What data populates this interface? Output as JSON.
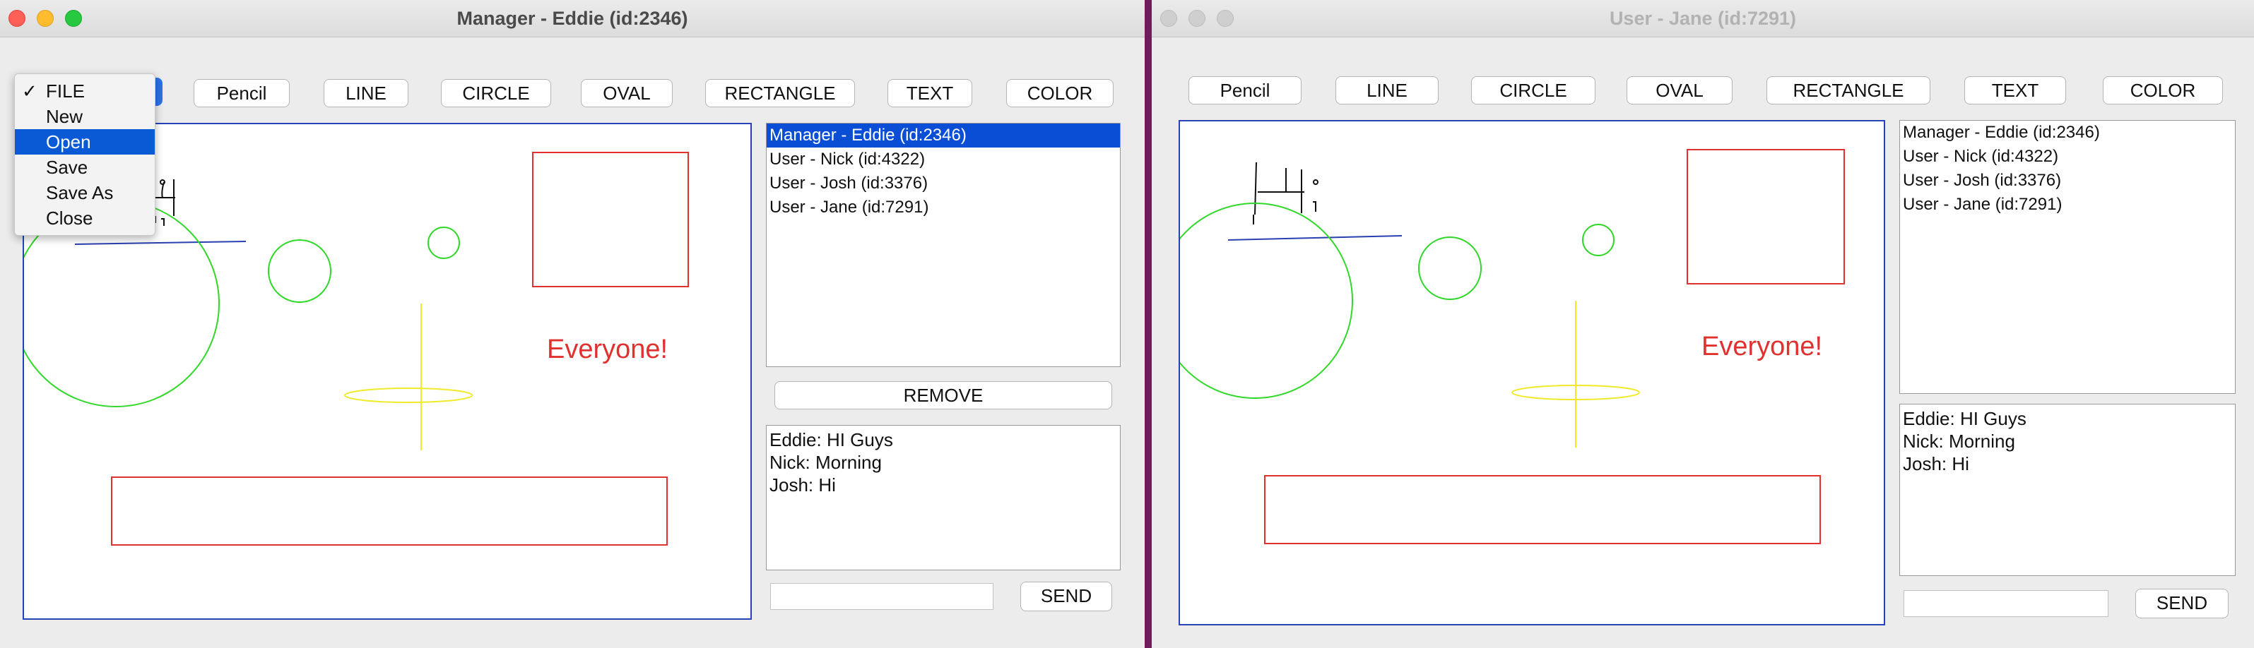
{
  "colors": {
    "canvas_border": "#2544b8",
    "red_shape": "#e0312f",
    "green_shape": "#31d82a",
    "yellow_shape": "#f0ea2a",
    "blue_line": "#2a3fb0",
    "selection": "#0a4ed6"
  },
  "manager_window": {
    "title": "Manager - Eddie (id:2346)",
    "file_menu": {
      "items": [
        {
          "label": "FILE",
          "checked": true
        },
        {
          "label": "New"
        },
        {
          "label": "Open",
          "highlighted": true
        },
        {
          "label": "Save"
        },
        {
          "label": "Save As"
        },
        {
          "label": "Close"
        }
      ]
    },
    "toolbar": [
      "Pencil",
      "LINE",
      "CIRCLE",
      "OVAL",
      "RECTANGLE",
      "TEXT",
      "COLOR"
    ],
    "canvas_text": "Everyone!",
    "users": [
      "Manager - Eddie (id:2346)",
      "User - Nick (id:4322)",
      "User - Josh (id:3376)",
      "User - Jane (id:7291)"
    ],
    "selected_user_index": 0,
    "remove_label": "REMOVE",
    "chat": [
      "Eddie: HI Guys",
      "Nick: Morning",
      "Josh: Hi"
    ],
    "message_input": "",
    "send_label": "SEND"
  },
  "user_window": {
    "title": "User - Jane (id:7291)",
    "toolbar": [
      "Pencil",
      "LINE",
      "CIRCLE",
      "OVAL",
      "RECTANGLE",
      "TEXT",
      "COLOR"
    ],
    "canvas_text": "Everyone!",
    "users": [
      "Manager - Eddie (id:2346)",
      "User - Nick (id:4322)",
      "User - Josh (id:3376)",
      "User - Jane (id:7291)"
    ],
    "chat": [
      "Eddie: HI Guys",
      "Nick: Morning",
      "Josh: Hi"
    ],
    "message_input": "",
    "send_label": "SEND"
  }
}
